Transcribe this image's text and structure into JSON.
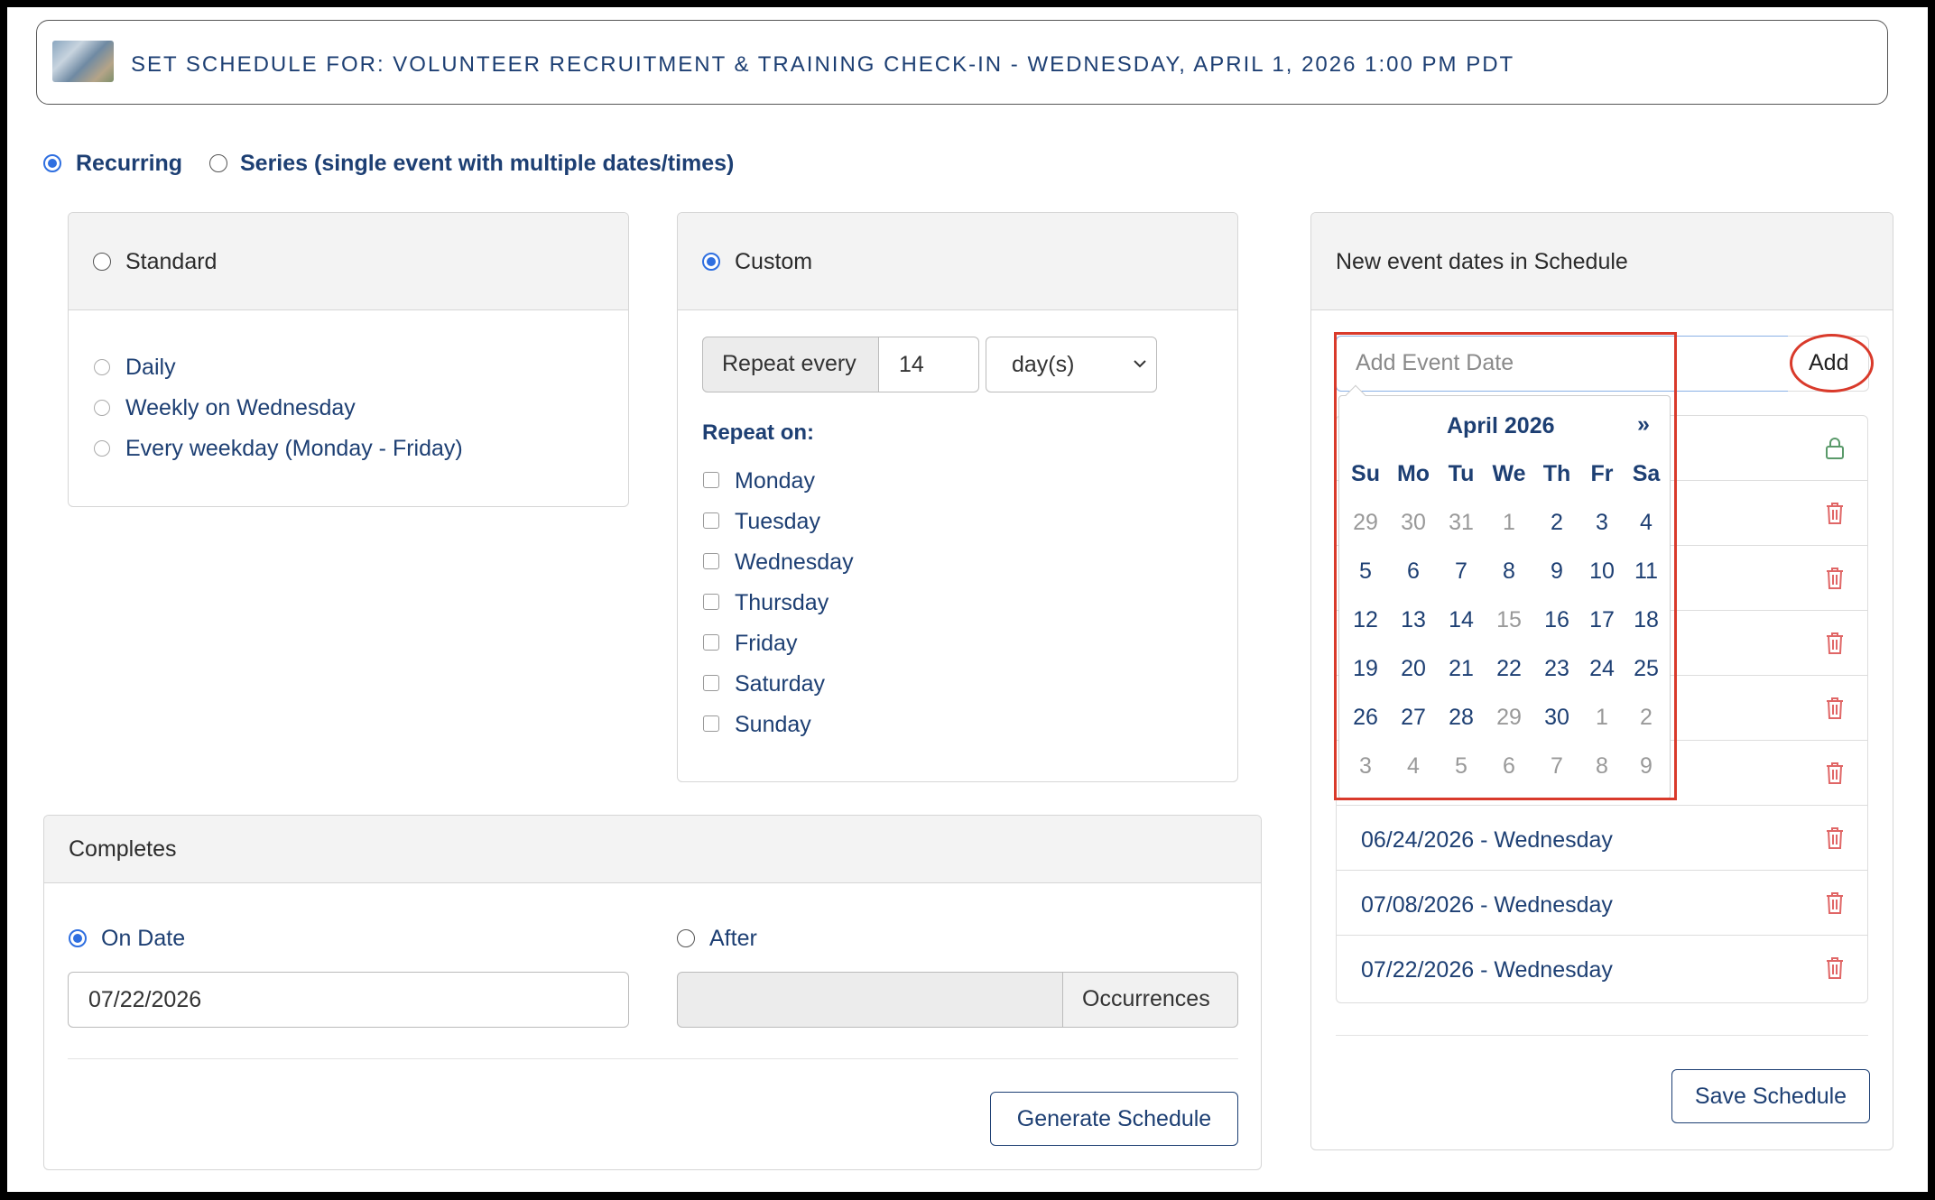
{
  "header": {
    "title": "SET SCHEDULE FOR: VOLUNTEER RECRUITMENT & TRAINING CHECK-IN - WEDNESDAY, APRIL 1, 2026 1:00 PM PDT"
  },
  "schedule_type": {
    "recurring": "Recurring",
    "series": "Series (single event with multiple dates/times)"
  },
  "standard": {
    "title": "Standard",
    "options": [
      "Daily",
      "Weekly on Wednesday",
      "Every weekday (Monday - Friday)"
    ]
  },
  "custom": {
    "title": "Custom",
    "repeat_every_label": "Repeat every",
    "repeat_every_value": "14",
    "unit": "day(s)",
    "repeat_on_label": "Repeat on:",
    "days": [
      "Monday",
      "Tuesday",
      "Wednesday",
      "Thursday",
      "Friday",
      "Saturday",
      "Sunday"
    ]
  },
  "completes": {
    "title": "Completes",
    "on_date_label": "On Date",
    "on_date_value": "07/22/2026",
    "after_label": "After",
    "occurrences_label": "Occurrences",
    "generate_button": "Generate Schedule"
  },
  "dates_panel": {
    "title": "New event dates in Schedule",
    "add_placeholder": "Add Event Date",
    "add_button": "Add",
    "items": [
      "06/24/2026 - Wednesday",
      "07/08/2026 - Wednesday",
      "07/22/2026 - Wednesday"
    ],
    "save_button": "Save Schedule"
  },
  "calendar": {
    "month_label": "April 2026",
    "next": "»",
    "weekdays": [
      "Su",
      "Mo",
      "Tu",
      "We",
      "Th",
      "Fr",
      "Sa"
    ],
    "weeks": [
      [
        [
          "29",
          "o"
        ],
        [
          "30",
          "o"
        ],
        [
          "31",
          "o"
        ],
        [
          "1",
          "o"
        ],
        [
          "2",
          "c"
        ],
        [
          "3",
          "c"
        ],
        [
          "4",
          "c"
        ]
      ],
      [
        [
          "5",
          "c"
        ],
        [
          "6",
          "c"
        ],
        [
          "7",
          "c"
        ],
        [
          "8",
          "c"
        ],
        [
          "9",
          "c"
        ],
        [
          "10",
          "c"
        ],
        [
          "11",
          "c"
        ]
      ],
      [
        [
          "12",
          "c"
        ],
        [
          "13",
          "c"
        ],
        [
          "14",
          "c"
        ],
        [
          "15",
          "o"
        ],
        [
          "16",
          "c"
        ],
        [
          "17",
          "c"
        ],
        [
          "18",
          "c"
        ]
      ],
      [
        [
          "19",
          "c"
        ],
        [
          "20",
          "c"
        ],
        [
          "21",
          "c"
        ],
        [
          "22",
          "c"
        ],
        [
          "23",
          "c"
        ],
        [
          "24",
          "c"
        ],
        [
          "25",
          "c"
        ]
      ],
      [
        [
          "26",
          "c"
        ],
        [
          "27",
          "c"
        ],
        [
          "28",
          "c"
        ],
        [
          "29",
          "o"
        ],
        [
          "30",
          "c"
        ],
        [
          "1",
          "o"
        ],
        [
          "2",
          "o"
        ]
      ],
      [
        [
          "3",
          "o"
        ],
        [
          "4",
          "o"
        ],
        [
          "5",
          "o"
        ],
        [
          "6",
          "o"
        ],
        [
          "7",
          "o"
        ],
        [
          "8",
          "o"
        ],
        [
          "9",
          "o"
        ]
      ]
    ]
  },
  "colors": {
    "text_blue": "#1d3f73",
    "radio_blue": "#2f6fe0",
    "highlight_red": "#d93a2b",
    "trash_red": "#e06666",
    "lock_green": "#5a9a6a"
  }
}
